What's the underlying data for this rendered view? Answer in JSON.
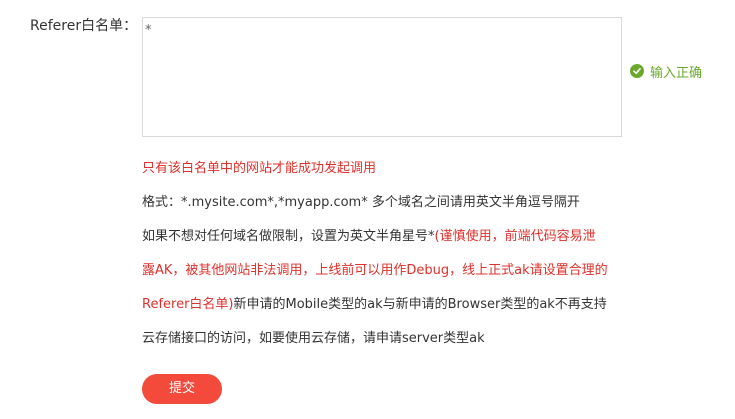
{
  "form": {
    "referer_label": "Referer白名单：",
    "referer_value": "*",
    "validation_text": "输入正确",
    "submit_label": "提交"
  },
  "notes": {
    "only_whitelist": "只有该白名单中的网站才能成功发起调用",
    "format": "格式：*.mysite.com*,*myapp.com* 多个域名之间请用英文半角逗号隔开",
    "line3_normal": "如果不想对任何域名做限制，设置为英文半角星号*",
    "line3_red": "(谨慎使用，前端代码容易泄",
    "line4_red": "露AK，被其他网站非法调用，上线前可以用作Debug，线上正式ak请设置合理的",
    "line5_red": "Referer白名单)",
    "line5_normal": "新申请的Mobile类型的ak与新申请的Browser类型的ak不再支持",
    "line6_normal": "云存储接口的访问，如要使用云存储，请申请server类型ak"
  },
  "colors": {
    "error_red": "#e0302b",
    "success_green": "#6aa92e",
    "button_bg": "#f34a3c"
  },
  "icons": {
    "validation": "check-circle-icon"
  }
}
